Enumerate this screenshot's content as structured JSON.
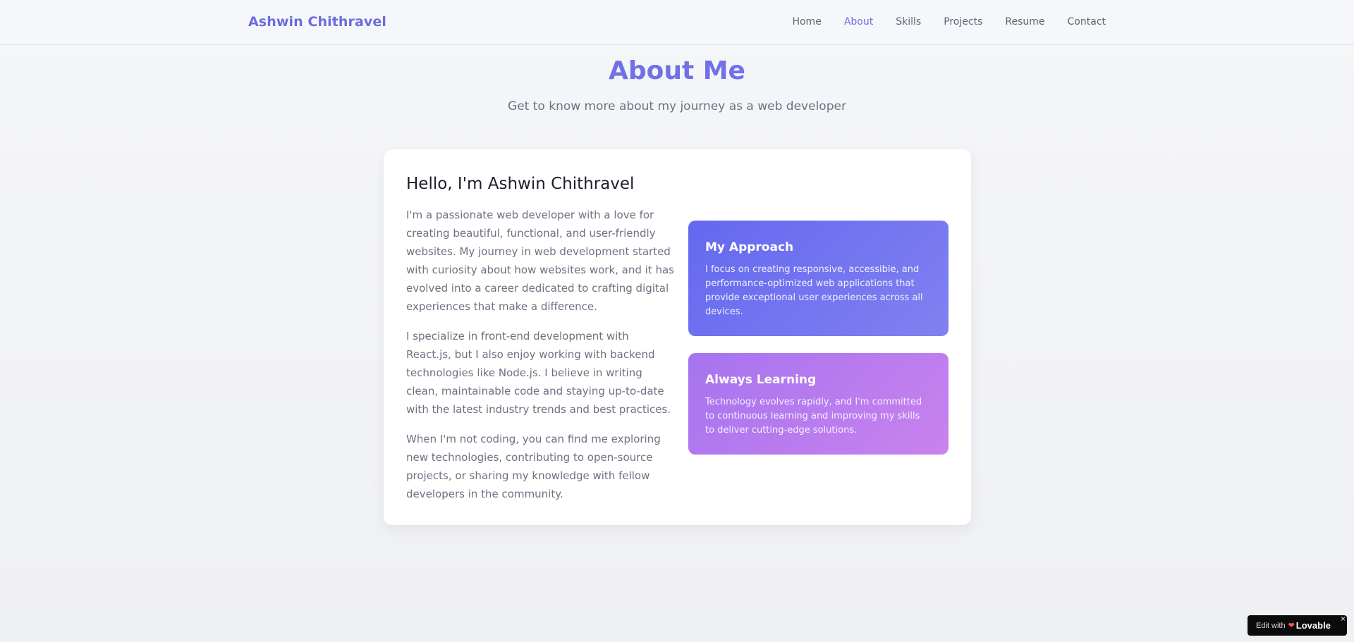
{
  "header": {
    "brand": "Ashwin Chithravel",
    "nav": [
      {
        "label": "Home"
      },
      {
        "label": "About"
      },
      {
        "label": "Skills"
      },
      {
        "label": "Projects"
      },
      {
        "label": "Resume"
      },
      {
        "label": "Contact"
      }
    ],
    "active": "About"
  },
  "page": {
    "title": "About Me",
    "subtitle": "Get to know more about my journey as a web developer"
  },
  "about": {
    "heading": "Hello, I'm Ashwin Chithravel",
    "paragraphs": [
      "I'm a passionate web developer with a love for creating beautiful, functional, and user-friendly websites. My journey in web development started with curiosity about how websites work, and it has evolved into a career dedicated to crafting digital experiences that make a difference.",
      "I specialize in front-end development with React.js, but I also enjoy working with backend technologies like Node.js. I believe in writing clean, maintainable code and staying up-to-date with the latest industry trends and best practices.",
      "When I'm not coding, you can find me exploring new technologies, contributing to open-source projects, or sharing my knowledge with fellow developers in the community."
    ],
    "cards": [
      {
        "title": "My Approach",
        "text": "I focus on creating responsive, accessible, and performance-optimized web applications that provide exceptional user experiences across all devices."
      },
      {
        "title": "Always Learning",
        "text": "Technology evolves rapidly, and I'm committed to continuous learning and improving my skills to deliver cutting-edge solutions."
      }
    ]
  },
  "badge": {
    "edit_label": "Edit with",
    "brand": "Lovable",
    "heart_icon": "heart-icon",
    "close_label": "×"
  },
  "colors": {
    "accent": "#6b6be4",
    "approach_gradient": [
      "#6468ef",
      "#8181f0"
    ],
    "learning_gradient": [
      "#a674ef",
      "#c982ee"
    ]
  }
}
